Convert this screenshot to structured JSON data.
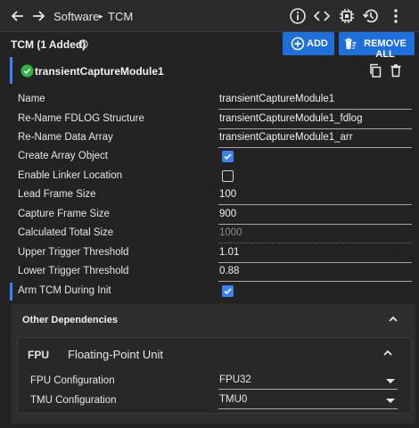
{
  "topbar": {
    "breadcrumb": [
      "Software",
      "TCM"
    ],
    "icons": [
      "back-arrow-icon",
      "forward-arrow-icon",
      "info-icon",
      "code-icon",
      "chip-icon",
      "history-icon",
      "more-vert-icon"
    ]
  },
  "header": {
    "title": "TCM (1 Added)",
    "add_label": "ADD",
    "remove_all_label": "REMOVE ALL"
  },
  "module": {
    "name": "transientCaptureModule1"
  },
  "fields": [
    {
      "label": "Name",
      "type": "text",
      "value": "transientCaptureModule1"
    },
    {
      "label": "Re-Name FDLOG Structure",
      "type": "text",
      "value": "transientCaptureModule1_fdlog"
    },
    {
      "label": "Re-Name Data Array",
      "type": "text",
      "value": "transientCaptureModule1_arr"
    },
    {
      "label": "Create Array Object",
      "type": "checkbox",
      "checked": true
    },
    {
      "label": "Enable Linker Location",
      "type": "checkbox",
      "checked": false
    },
    {
      "label": "Lead Frame Size",
      "type": "text",
      "value": "100"
    },
    {
      "label": "Capture Frame Size",
      "type": "text",
      "value": "900"
    },
    {
      "label": "Calculated Total Size",
      "type": "readonly",
      "value": "1000"
    },
    {
      "label": "Upper Trigger Threshold",
      "type": "text",
      "value": "1.01"
    },
    {
      "label": "Lower Trigger Threshold",
      "type": "text",
      "value": "0.88"
    },
    {
      "label": "Arm TCM During Init",
      "type": "checkbox",
      "checked": true
    }
  ],
  "dependencies": {
    "title": "Other Dependencies",
    "module_abbr": "FPU",
    "module_full": "Floating-Point Unit",
    "settings": [
      {
        "label": "FPU Configuration",
        "value": "FPU32"
      },
      {
        "label": "TMU Configuration",
        "value": "TMU0"
      }
    ]
  },
  "colors": {
    "accent": "#1e6fd9",
    "check": "#3b82f6",
    "success": "#2fb344"
  }
}
